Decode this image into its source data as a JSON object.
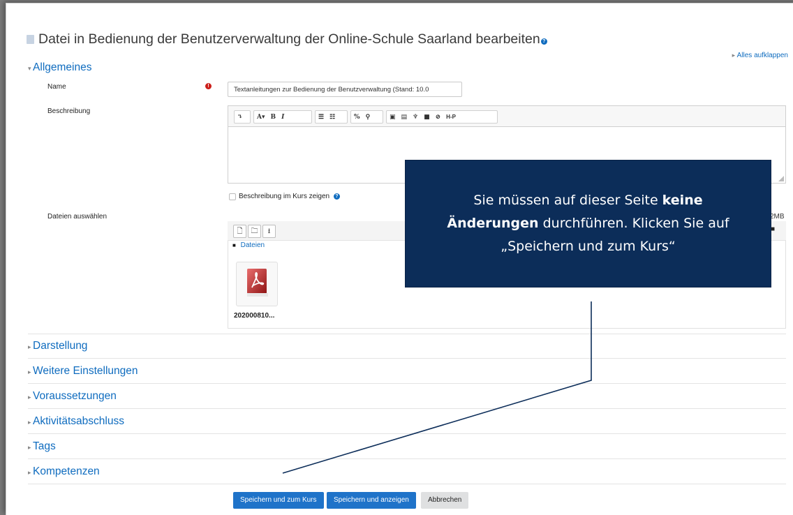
{
  "page": {
    "title": "Datei in Bedienung der Benutzerverwaltung der Online-Schule Saarland bearbeiten",
    "expand_all": "Alles aufklappen"
  },
  "general": {
    "heading": "Allgemeines",
    "name_label": "Name",
    "name_value": "Textanleitungen zur Bedienung der Benutzverwaltung (Stand: 10.0",
    "description_label": "Beschreibung",
    "show_description_label": "Beschreibung im Kurs zeigen",
    "files_label": "Dateien auswählen",
    "max_size": "2MB",
    "folder_label": "Dateien",
    "file_name": "202000810..."
  },
  "editor_toolbar": {
    "buttons": [
      "↴",
      "A▾",
      "B",
      "I",
      "☰",
      "☷",
      "%",
      "⚲",
      "▣",
      "▤",
      "♆",
      "■",
      "⊘",
      "H-P"
    ]
  },
  "sections": [
    {
      "label": "Darstellung"
    },
    {
      "label": "Weitere Einstellungen"
    },
    {
      "label": "Voraussetzungen"
    },
    {
      "label": "Aktivitätsabschluss"
    },
    {
      "label": "Tags"
    },
    {
      "label": "Kompetenzen"
    }
  ],
  "buttons": {
    "save_return": "Speichern und zum Kurs",
    "save_display": "Speichern und anzeigen",
    "cancel": "Abbrechen"
  },
  "callout": {
    "part1": "Sie müssen auf dieser Seite ",
    "bold1": "keine",
    "bold2": "Änderungen",
    "part2": " durchführen. Klicken Sie auf „Speichern und zum Kurs“"
  },
  "colors": {
    "link": "#0f6cbf",
    "primary_button": "#1f73c9",
    "callout_bg": "#0c2d59",
    "required": "#cc1f1a"
  },
  "icons": {
    "title": "document-icon",
    "help": "help-icon",
    "required": "required-icon",
    "pdf": "pdf-file-icon",
    "folder": "folder-icon"
  }
}
